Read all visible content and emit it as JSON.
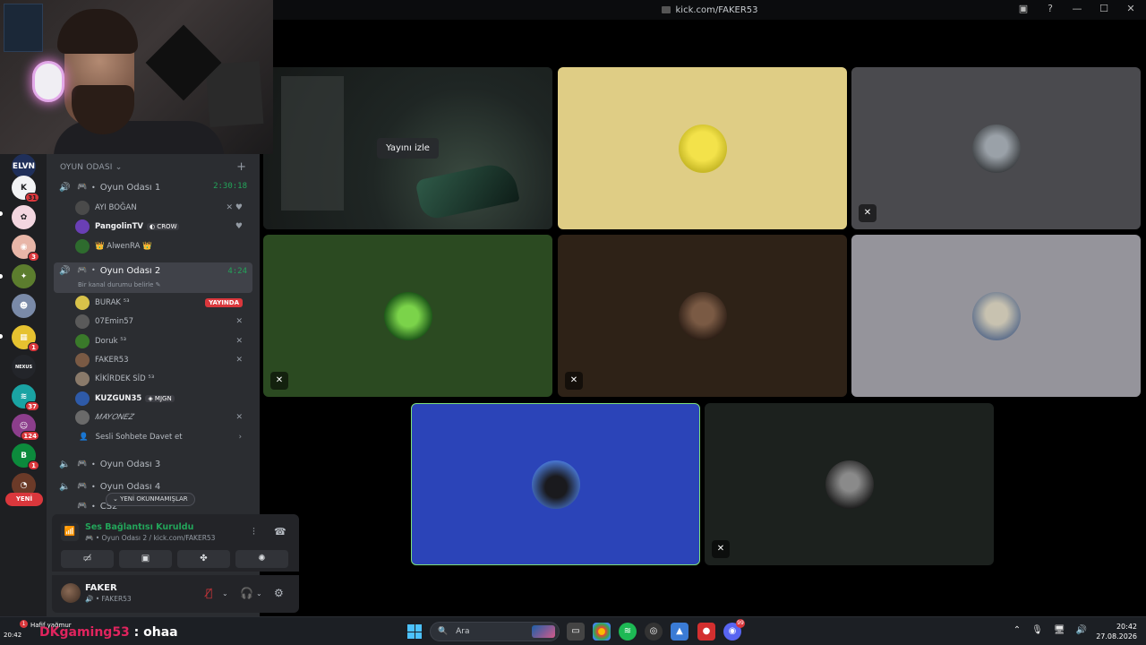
{
  "titlebar": {
    "url": "kick.com/FAKER53",
    "controls": [
      "▣",
      "?",
      "—",
      "☐",
      "✕"
    ]
  },
  "servers": [
    {
      "label": "ELVN",
      "color": "#1f2f5a",
      "badge": ""
    },
    {
      "label": "K",
      "color": "#f2f3f5",
      "badge": "31"
    },
    {
      "label": "✿",
      "color": "#f3d6e0",
      "badge": ""
    },
    {
      "label": "◉",
      "color": "#e8b6a8",
      "badge": "3"
    },
    {
      "label": "✦",
      "color": "#5c7d2e",
      "badge": ""
    },
    {
      "label": "☻",
      "color": "#7a8aa8",
      "badge": ""
    },
    {
      "label": "▦",
      "color": "#e6c230",
      "badge": "1"
    },
    {
      "label": "NEXUS",
      "color": "#23252a",
      "badge": ""
    },
    {
      "label": "≋",
      "color": "#1aa3a3",
      "badge": "37"
    },
    {
      "label": "☺",
      "color": "#8c3e8c",
      "badge": "124"
    },
    {
      "label": "B",
      "color": "#0c8a3c",
      "badge": "1"
    },
    {
      "label": "◔",
      "color": "#6b3a28",
      "badge": ""
    }
  ],
  "rail": {
    "new_label": "YENİ"
  },
  "sidebar": {
    "category": "OYUN ODASI ⌄",
    "channels": {
      "c1": {
        "name": "Oyun Odası 1",
        "timer": "2:30:18"
      },
      "c2": {
        "name": "Oyun Odası 2",
        "timer": "4:24",
        "status": "Bir kanal durumu belirle ✎"
      },
      "c3": {
        "name": "Oyun Odası 3"
      },
      "c4": {
        "name": "Oyun Odası 4"
      },
      "c5": {
        "name": "CS2"
      }
    },
    "c1_users": [
      {
        "name": "AYI BOĞAN",
        "tag": "",
        "av": "#4a4a4a",
        "mic": "✕̸"
      },
      {
        "name": "PangolinTV",
        "tag": "◐ CROW",
        "av": "#6a3fb5",
        "mic": ""
      },
      {
        "name": "👑 AlwenRA 👑",
        "tag": "",
        "av": "#2e6b2e",
        "mic": ""
      }
    ],
    "c2_users": [
      {
        "name": "BURAK ⁵³",
        "tag": "",
        "av": "#d8c24a",
        "live": "YAYINDA"
      },
      {
        "name": "07Emin57",
        "tag": "",
        "av": "#5a5a5a",
        "mic": "✕̸"
      },
      {
        "name": "Doruk ⁵³",
        "tag": "",
        "av": "#3a7a2a",
        "mic": "✕̸"
      },
      {
        "name": "FAKER53",
        "tag": "",
        "av": "#7a5a44",
        "mic": "✕̸"
      },
      {
        "name": "KİKİRDEK SİD ⁵³",
        "tag": "",
        "av": "#8a7a6a"
      },
      {
        "name": "KUZGUN35",
        "tag": "◈ MJGN",
        "av": "#2e5aa8"
      },
      {
        "name": "𝑀𝐴𝑌𝑂𝑁𝐸𝑍",
        "tag": "",
        "av": "#6a6a6a",
        "mic": "✕̸"
      }
    ],
    "invite": "Sesli Sohbete Davet et",
    "unread": "⌄ YENİ OKUNMAMIŞLAR"
  },
  "voice": {
    "title": "Ses Bağlantısı Kuruldu",
    "sub": "🎮 • Oyun Odası 2 / kick.com/FAKER53",
    "buttons": [
      "▭̸",
      "▣",
      "✤",
      "✺"
    ]
  },
  "user": {
    "name": "FAKER",
    "sub": "🔊 • FAKER53"
  },
  "tiles": {
    "watch": "Yayını izle"
  },
  "taskbar": {
    "weather": "Hafif yağmur",
    "temp": "20:42",
    "badge": "1",
    "chat_user": "DKgaming53",
    "chat_msg": " : ohaa",
    "search": "Ara",
    "time": "20:42",
    "date": "27.08.2026",
    "discord_badge": "99"
  },
  "colors": {
    "discord_green": "#23a55a",
    "discord_red": "#da373c",
    "speaking_border": "#7ee07e",
    "kick_user": "#e0245e"
  }
}
